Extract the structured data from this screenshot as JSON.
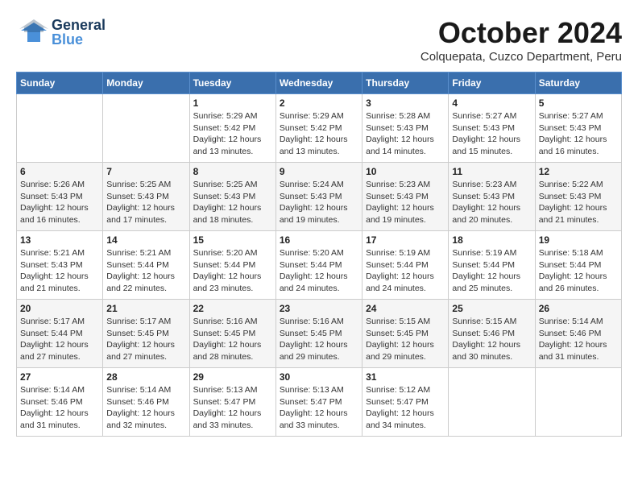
{
  "header": {
    "logo_general": "General",
    "logo_blue": "Blue",
    "month_title": "October 2024",
    "subtitle": "Colquepata, Cuzco Department, Peru"
  },
  "calendar": {
    "days_of_week": [
      "Sunday",
      "Monday",
      "Tuesday",
      "Wednesday",
      "Thursday",
      "Friday",
      "Saturday"
    ],
    "weeks": [
      [
        {
          "day": "",
          "sunrise": "",
          "sunset": "",
          "daylight": ""
        },
        {
          "day": "",
          "sunrise": "",
          "sunset": "",
          "daylight": ""
        },
        {
          "day": "1",
          "sunrise": "Sunrise: 5:29 AM",
          "sunset": "Sunset: 5:42 PM",
          "daylight": "Daylight: 12 hours and 13 minutes."
        },
        {
          "day": "2",
          "sunrise": "Sunrise: 5:29 AM",
          "sunset": "Sunset: 5:42 PM",
          "daylight": "Daylight: 12 hours and 13 minutes."
        },
        {
          "day": "3",
          "sunrise": "Sunrise: 5:28 AM",
          "sunset": "Sunset: 5:43 PM",
          "daylight": "Daylight: 12 hours and 14 minutes."
        },
        {
          "day": "4",
          "sunrise": "Sunrise: 5:27 AM",
          "sunset": "Sunset: 5:43 PM",
          "daylight": "Daylight: 12 hours and 15 minutes."
        },
        {
          "day": "5",
          "sunrise": "Sunrise: 5:27 AM",
          "sunset": "Sunset: 5:43 PM",
          "daylight": "Daylight: 12 hours and 16 minutes."
        }
      ],
      [
        {
          "day": "6",
          "sunrise": "Sunrise: 5:26 AM",
          "sunset": "Sunset: 5:43 PM",
          "daylight": "Daylight: 12 hours and 16 minutes."
        },
        {
          "day": "7",
          "sunrise": "Sunrise: 5:25 AM",
          "sunset": "Sunset: 5:43 PM",
          "daylight": "Daylight: 12 hours and 17 minutes."
        },
        {
          "day": "8",
          "sunrise": "Sunrise: 5:25 AM",
          "sunset": "Sunset: 5:43 PM",
          "daylight": "Daylight: 12 hours and 18 minutes."
        },
        {
          "day": "9",
          "sunrise": "Sunrise: 5:24 AM",
          "sunset": "Sunset: 5:43 PM",
          "daylight": "Daylight: 12 hours and 19 minutes."
        },
        {
          "day": "10",
          "sunrise": "Sunrise: 5:23 AM",
          "sunset": "Sunset: 5:43 PM",
          "daylight": "Daylight: 12 hours and 19 minutes."
        },
        {
          "day": "11",
          "sunrise": "Sunrise: 5:23 AM",
          "sunset": "Sunset: 5:43 PM",
          "daylight": "Daylight: 12 hours and 20 minutes."
        },
        {
          "day": "12",
          "sunrise": "Sunrise: 5:22 AM",
          "sunset": "Sunset: 5:43 PM",
          "daylight": "Daylight: 12 hours and 21 minutes."
        }
      ],
      [
        {
          "day": "13",
          "sunrise": "Sunrise: 5:21 AM",
          "sunset": "Sunset: 5:43 PM",
          "daylight": "Daylight: 12 hours and 21 minutes."
        },
        {
          "day": "14",
          "sunrise": "Sunrise: 5:21 AM",
          "sunset": "Sunset: 5:44 PM",
          "daylight": "Daylight: 12 hours and 22 minutes."
        },
        {
          "day": "15",
          "sunrise": "Sunrise: 5:20 AM",
          "sunset": "Sunset: 5:44 PM",
          "daylight": "Daylight: 12 hours and 23 minutes."
        },
        {
          "day": "16",
          "sunrise": "Sunrise: 5:20 AM",
          "sunset": "Sunset: 5:44 PM",
          "daylight": "Daylight: 12 hours and 24 minutes."
        },
        {
          "day": "17",
          "sunrise": "Sunrise: 5:19 AM",
          "sunset": "Sunset: 5:44 PM",
          "daylight": "Daylight: 12 hours and 24 minutes."
        },
        {
          "day": "18",
          "sunrise": "Sunrise: 5:19 AM",
          "sunset": "Sunset: 5:44 PM",
          "daylight": "Daylight: 12 hours and 25 minutes."
        },
        {
          "day": "19",
          "sunrise": "Sunrise: 5:18 AM",
          "sunset": "Sunset: 5:44 PM",
          "daylight": "Daylight: 12 hours and 26 minutes."
        }
      ],
      [
        {
          "day": "20",
          "sunrise": "Sunrise: 5:17 AM",
          "sunset": "Sunset: 5:44 PM",
          "daylight": "Daylight: 12 hours and 27 minutes."
        },
        {
          "day": "21",
          "sunrise": "Sunrise: 5:17 AM",
          "sunset": "Sunset: 5:45 PM",
          "daylight": "Daylight: 12 hours and 27 minutes."
        },
        {
          "day": "22",
          "sunrise": "Sunrise: 5:16 AM",
          "sunset": "Sunset: 5:45 PM",
          "daylight": "Daylight: 12 hours and 28 minutes."
        },
        {
          "day": "23",
          "sunrise": "Sunrise: 5:16 AM",
          "sunset": "Sunset: 5:45 PM",
          "daylight": "Daylight: 12 hours and 29 minutes."
        },
        {
          "day": "24",
          "sunrise": "Sunrise: 5:15 AM",
          "sunset": "Sunset: 5:45 PM",
          "daylight": "Daylight: 12 hours and 29 minutes."
        },
        {
          "day": "25",
          "sunrise": "Sunrise: 5:15 AM",
          "sunset": "Sunset: 5:46 PM",
          "daylight": "Daylight: 12 hours and 30 minutes."
        },
        {
          "day": "26",
          "sunrise": "Sunrise: 5:14 AM",
          "sunset": "Sunset: 5:46 PM",
          "daylight": "Daylight: 12 hours and 31 minutes."
        }
      ],
      [
        {
          "day": "27",
          "sunrise": "Sunrise: 5:14 AM",
          "sunset": "Sunset: 5:46 PM",
          "daylight": "Daylight: 12 hours and 31 minutes."
        },
        {
          "day": "28",
          "sunrise": "Sunrise: 5:14 AM",
          "sunset": "Sunset: 5:46 PM",
          "daylight": "Daylight: 12 hours and 32 minutes."
        },
        {
          "day": "29",
          "sunrise": "Sunrise: 5:13 AM",
          "sunset": "Sunset: 5:47 PM",
          "daylight": "Daylight: 12 hours and 33 minutes."
        },
        {
          "day": "30",
          "sunrise": "Sunrise: 5:13 AM",
          "sunset": "Sunset: 5:47 PM",
          "daylight": "Daylight: 12 hours and 33 minutes."
        },
        {
          "day": "31",
          "sunrise": "Sunrise: 5:12 AM",
          "sunset": "Sunset: 5:47 PM",
          "daylight": "Daylight: 12 hours and 34 minutes."
        },
        {
          "day": "",
          "sunrise": "",
          "sunset": "",
          "daylight": ""
        },
        {
          "day": "",
          "sunrise": "",
          "sunset": "",
          "daylight": ""
        }
      ]
    ]
  }
}
